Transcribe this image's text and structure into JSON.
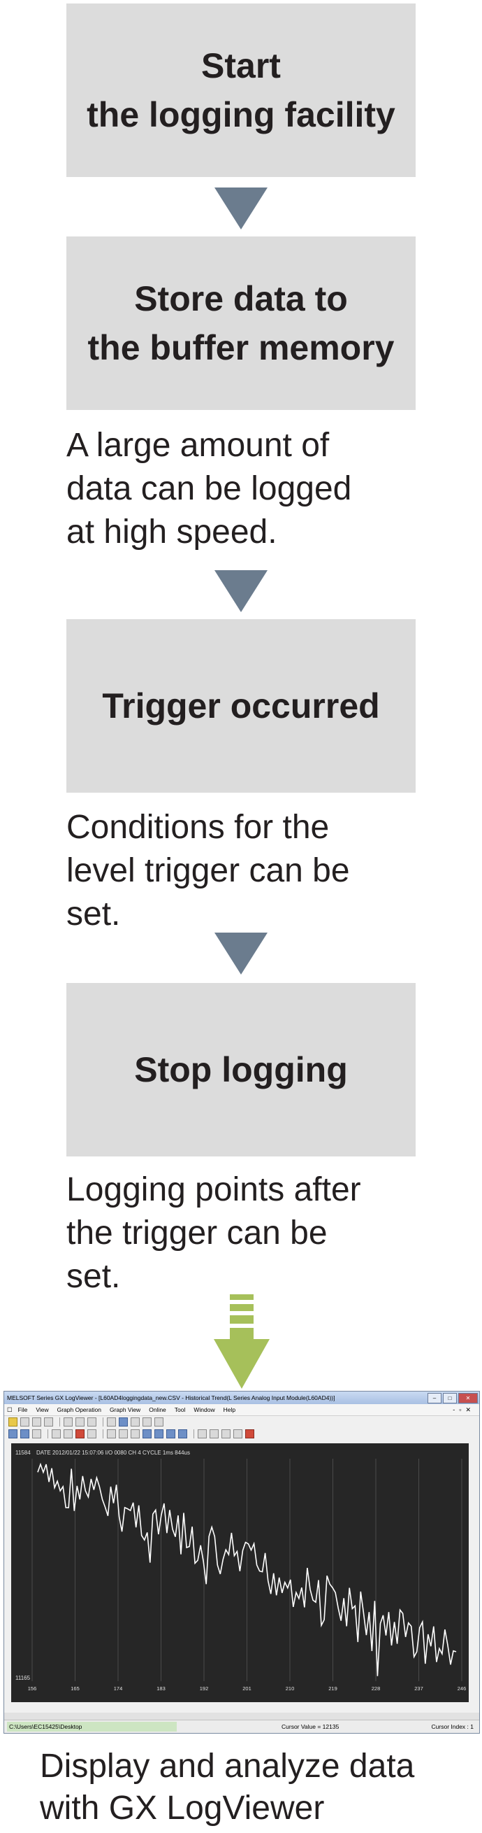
{
  "steps": [
    {
      "lines": [
        "Start",
        "the logging facility"
      ]
    },
    {
      "lines": [
        "Store data to",
        "the buffer memory"
      ]
    },
    {
      "lines": [
        "Trigger occurred"
      ]
    },
    {
      "lines": [
        "Stop logging"
      ]
    }
  ],
  "descriptions": [
    {
      "lines": [
        "A large amount of",
        "data can be logged",
        "at high speed."
      ]
    },
    {
      "lines": [
        "Conditions for the",
        "level trigger can be",
        "set."
      ]
    },
    {
      "lines": [
        "Logging points after",
        "the trigger can be",
        "set."
      ]
    }
  ],
  "colors": {
    "box": "#dcdcdc",
    "arrow": "#6b7c8e",
    "big_arrow": "#a6c05a",
    "text": "#231f20"
  },
  "window": {
    "title": "MELSOFT Series GX LogViewer - [L60AD4loggingdata_new.CSV - Historical Trend(L Series Analog Input Module(L60AD4))]",
    "menu": [
      "File",
      "View",
      "Graph Operation",
      "Graph View",
      "Online",
      "Tool",
      "Window",
      "Help"
    ],
    "graph_header": "DATE 2012/01/22  15:07:06  I/O 0080  CH 4  CYCLE  1ms  844us",
    "y_top": "11584",
    "y_bottom": "11165",
    "x_ticks": [
      "156",
      "165",
      "174",
      "183",
      "192",
      "201",
      "210",
      "219",
      "228",
      "237",
      "246"
    ],
    "status_path": "C:\\Users\\EC15425\\Desktop",
    "cursor_value": "Cursor Value = 12135",
    "cursor_index": "Cursor Index : 1"
  },
  "final_caption": {
    "lines": [
      "Display and analyze data",
      "with GX LogViewer"
    ]
  }
}
